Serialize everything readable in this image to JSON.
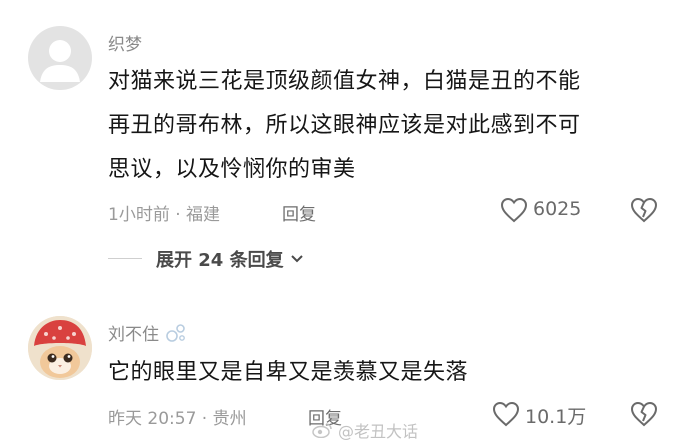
{
  "comments": [
    {
      "username": "织梦",
      "text_lines": [
        "对猫来说三花是顶级颜值女神，白猫是丑的不能",
        "再丑的哥布林，所以这眼神应该是对此感到不可",
        "思议，以及怜悯你的审美"
      ],
      "meta": "1小时前 · 福建",
      "reply_label": "回复",
      "likes": "6025",
      "avatar_icon": "default-user-avatar"
    },
    {
      "username": "刘不住",
      "text_lines": [
        "它的眼里又是自卑又是羡慕又是失落"
      ],
      "meta": "昨天 20:57 · 贵州",
      "reply_label": "回复",
      "likes": "10.1万",
      "avatar_icon": "cat-in-strawberry-hat-avatar"
    }
  ],
  "expand_replies_label": "展开 24 条回复",
  "watermark_text": "@老丑大话",
  "colors": {
    "text": "#161616",
    "muted": "#9a9a9a",
    "icon": "#6a6a6a"
  }
}
